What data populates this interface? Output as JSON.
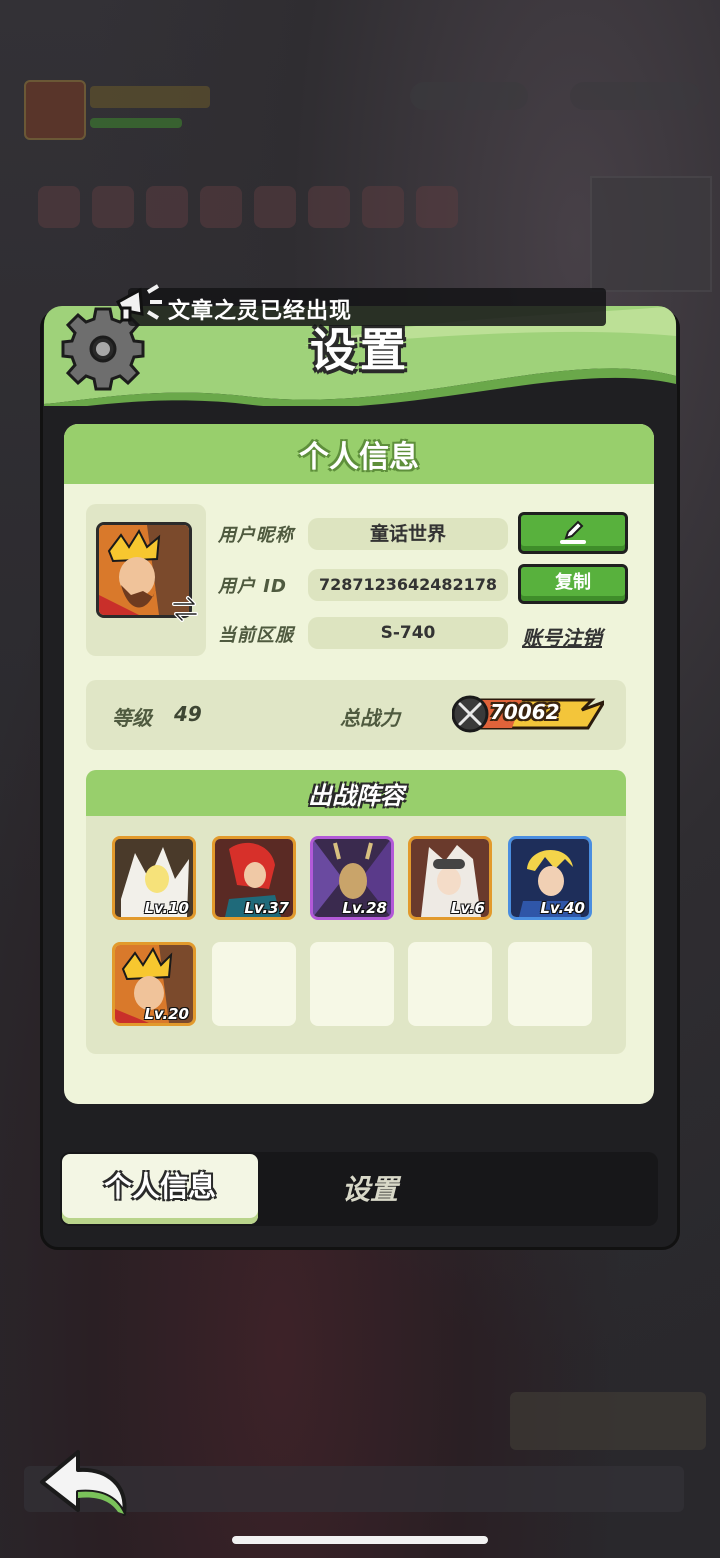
{
  "ticker": {
    "text": "文章之灵已经出现"
  },
  "panel": {
    "title": "设置"
  },
  "profile_card": {
    "title": "个人信息",
    "nickname_label": "用户昵称",
    "nickname_value": "童话世界",
    "id_label": "用户 ID",
    "id_value": "7287123642482178",
    "copy_label": "复制",
    "server_label": "当前区服",
    "server_value": "S-740",
    "logout_label": "账号注销"
  },
  "stats": {
    "level_label": "等级",
    "level_value": "49",
    "power_label": "总战力",
    "power_value": "70062"
  },
  "lineup": {
    "title": "出战阵容",
    "heroes": [
      {
        "level": "Lv.10",
        "rarity": "legendary"
      },
      {
        "level": "Lv.37",
        "rarity": "legendary"
      },
      {
        "level": "Lv.28",
        "rarity": "epic"
      },
      {
        "level": "Lv.6",
        "rarity": "legendary"
      },
      {
        "level": "Lv.40",
        "rarity": "rare"
      },
      {
        "level": "Lv.20",
        "rarity": "legendary"
      }
    ],
    "empty_slots": 4
  },
  "tabs": [
    {
      "label": "个人信息",
      "active": true
    },
    {
      "label": "设置",
      "active": false
    }
  ],
  "colors": {
    "card_bg": "#eff4da",
    "header_green": "#98cf6c",
    "button_green": "#58b13d",
    "legendary_border": "#e29a2c",
    "epic_border": "#b35ad8",
    "rare_border": "#4a8ee0"
  },
  "icons": [
    "gear-icon",
    "horn-icon",
    "edit-icon",
    "swap-icon",
    "swords-icon",
    "back-arrow-icon"
  ]
}
